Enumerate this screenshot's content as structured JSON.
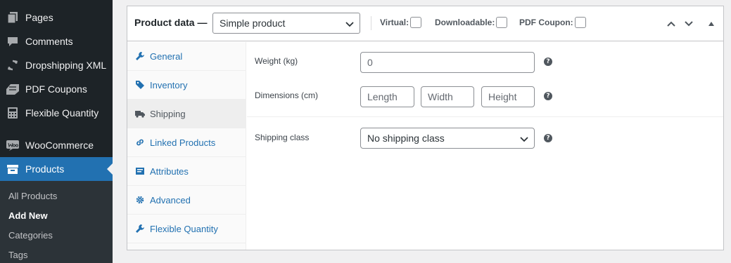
{
  "sidebar": {
    "items": [
      {
        "label": "Pages",
        "icon": "pages-icon"
      },
      {
        "label": "Comments",
        "icon": "comments-icon"
      },
      {
        "label": "Dropshipping XML",
        "icon": "refresh-icon"
      },
      {
        "label": "PDF Coupons",
        "icon": "coupons-icon"
      },
      {
        "label": "Flexible Quantity",
        "icon": "calculator-icon"
      },
      {
        "label": "WooCommerce",
        "icon": "woocommerce-icon"
      },
      {
        "label": "Products",
        "icon": "archive-icon"
      }
    ],
    "submenu": [
      "All Products",
      "Add New",
      "Categories",
      "Tags"
    ],
    "active": "Products",
    "current_submenu": "Add New"
  },
  "product_data": {
    "title": "Product data —",
    "type_value": "Simple product",
    "virtual_label": "Virtual:",
    "downloadable_label": "Downloadable:",
    "pdf_coupon_label": "PDF Coupon:"
  },
  "tabs": [
    "General",
    "Inventory",
    "Shipping",
    "Linked Products",
    "Attributes",
    "Advanced",
    "Flexible Quantity"
  ],
  "active_tab": "Shipping",
  "shipping": {
    "weight_label": "Weight (kg)",
    "weight_placeholder": "0",
    "dimensions_label": "Dimensions (cm)",
    "length_placeholder": "Length",
    "width_placeholder": "Width",
    "height_placeholder": "Height",
    "class_label": "Shipping class",
    "class_value": "No shipping class",
    "help_glyph": "?"
  },
  "colors": {
    "sidebar_bg": "#1d2327",
    "accent": "#2271b1",
    "submenu_bg": "#2c3338"
  }
}
